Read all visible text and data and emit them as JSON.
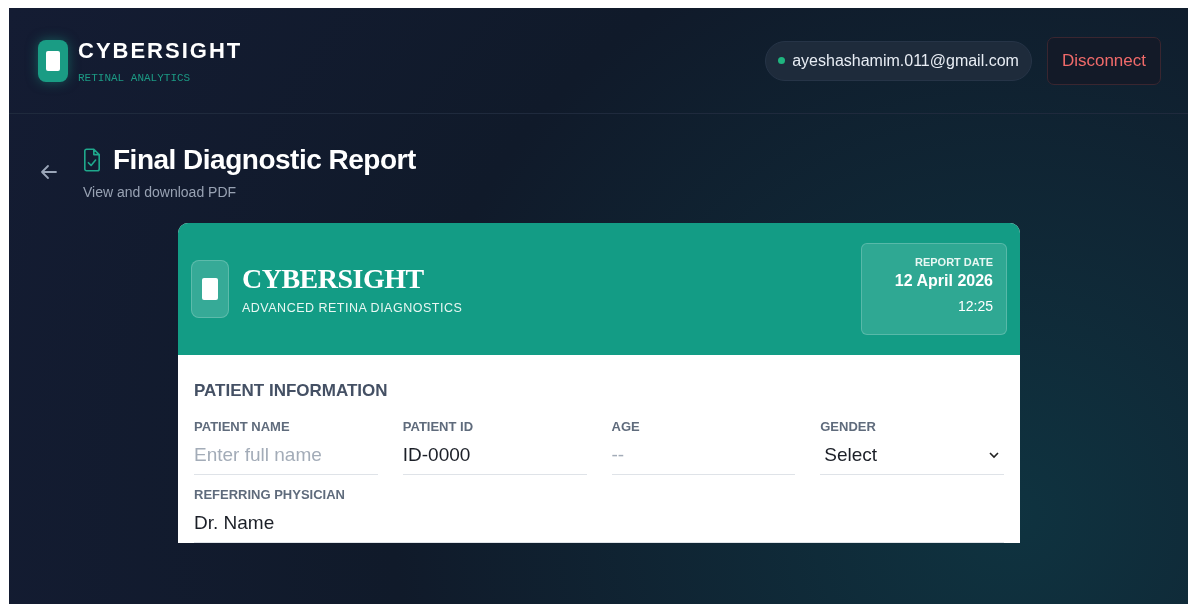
{
  "app": {
    "name": "CYBERSIGHT",
    "tagline": "RETINAL ANALYTICS"
  },
  "account": {
    "email": "ayeshashamim.011@gmail.com",
    "connected": true,
    "action": "Disconnect"
  },
  "page": {
    "title": "Final Diagnostic Report",
    "subtitle": "View and download PDF"
  },
  "report": {
    "brand": "CYBERSIGHT",
    "brand_sub": "ADVANCED RETINA DIAGNOSTICS",
    "date_label": "REPORT DATE",
    "date": "12 April 2026",
    "time": "12:25"
  },
  "section": {
    "title": "PATIENT INFORMATION",
    "fields": [
      {
        "kind": "input",
        "label": "PATIENT NAME",
        "placeholder": "Enter full name"
      },
      {
        "kind": "input",
        "label": "PATIENT ID",
        "value": "ID-0000"
      },
      {
        "kind": "input",
        "label": "AGE",
        "placeholder": "--"
      },
      {
        "kind": "select",
        "label": "GENDER",
        "value": "Select"
      },
      {
        "kind": "input",
        "label": "REFERRING PHYSICIAN",
        "value": "Dr. Name",
        "wide": true
      }
    ]
  }
}
